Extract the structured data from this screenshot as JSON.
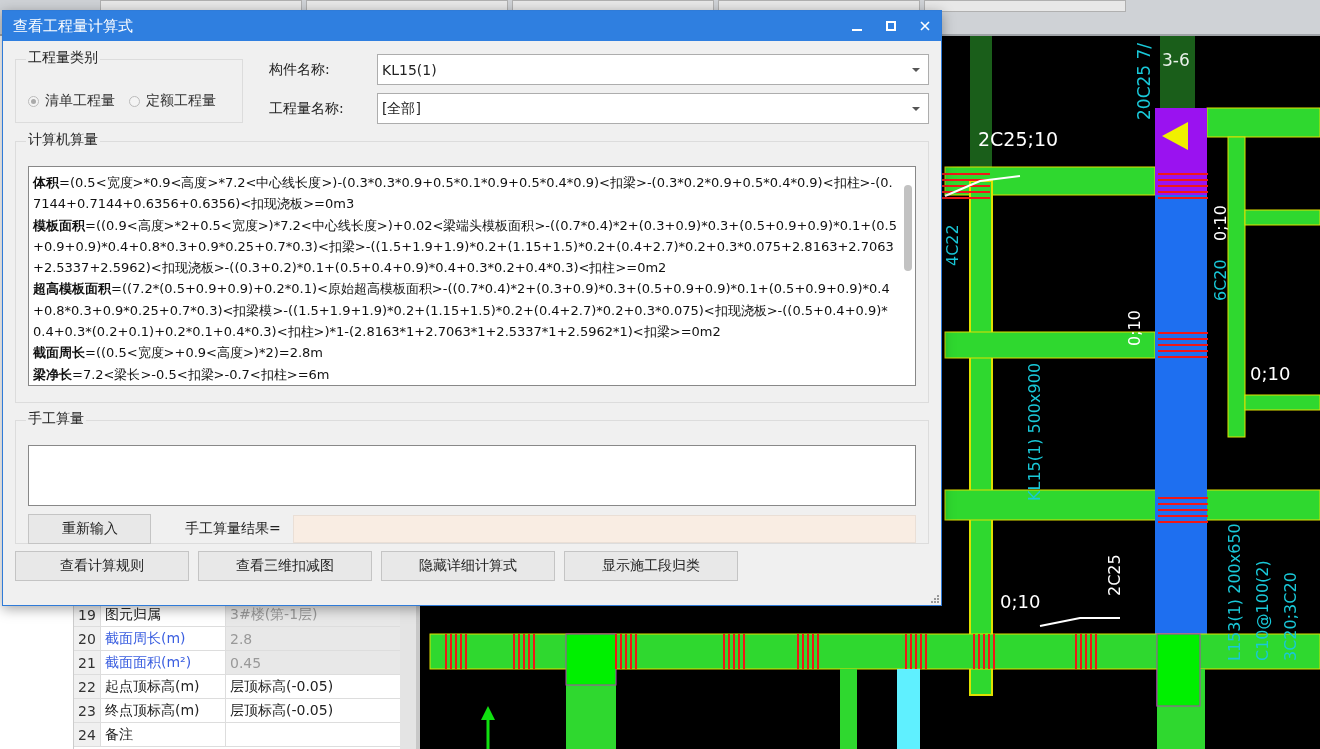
{
  "dialog": {
    "title": "查看工程量计算式",
    "category": {
      "legend": "工程量类别",
      "options": [
        {
          "label": "清单工程量",
          "selected": true
        },
        {
          "label": "定额工程量",
          "selected": false
        }
      ]
    },
    "fields": [
      {
        "label": "构件名称:",
        "value": "KL15(1)"
      },
      {
        "label": "工程量名称:",
        "value": "[全部]"
      }
    ],
    "computed": {
      "legend": "计算机算量",
      "lines": [
        {
          "label": "体积",
          "expr": "=(0.5<宽度>*0.9<高度>*7.2<中心线长度>)-(0.3*0.3*0.9+0.5*0.1*0.9+0.5*0.4*0.9)<扣梁>-(0.3*0.2*0.9+0.5*0.4*0.9)<扣柱>-(0.7144+0.7144+0.6356+0.6356)<扣现浇板>=0m3"
        },
        {
          "label": "模板面积",
          "expr": "=((0.9<高度>*2+0.5<宽度>)*7.2<中心线长度>)+0.02<梁端头模板面积>-((0.7*0.4)*2+(0.3+0.9)*0.3+(0.5+0.9+0.9)*0.1+(0.5+0.9+0.9)*0.4+0.8*0.3+0.9*0.25+0.7*0.3)<扣梁>-((1.5+1.9+1.9)*0.2+(1.15+1.5)*0.2+(0.4+2.7)*0.2+0.3*0.075+2.8163+2.7063+2.5337+2.5962)<扣现浇板>-((0.3+0.2)*0.1+(0.5+0.4+0.9)*0.4+0.3*0.2+0.4*0.3)<扣柱>=0m2"
        },
        {
          "label": "超高模板面积",
          "expr": "=((7.2*(0.5+0.9+0.9)+0.2*0.1)<原始超高模板面积>-((0.7*0.4)*2+(0.3+0.9)*0.3+(0.5+0.9+0.9)*0.1+(0.5+0.9+0.9)*0.4+0.8*0.3+0.9*0.25+0.7*0.3)<扣梁模>-((1.5+1.9+1.9)*0.2+(1.15+1.5)*0.2+(0.4+2.7)*0.2+0.3*0.075)<扣现浇板>-((0.5+0.4+0.9)*0.4+0.3*(0.2+0.1)+0.2*0.1+0.4*0.3)<扣柱>)*1-(2.8163*1+2.7063*1+2.5337*1+2.5962*1)<扣梁>=0m2"
        },
        {
          "label": "截面周长",
          "expr": "=((0.5<宽度>+0.9<高度>)*2)=2.8m"
        },
        {
          "label": "梁净长",
          "expr": "=7.2<梁长>-0.5<扣梁>-0.7<扣柱>=6m"
        }
      ]
    },
    "manual": {
      "legend": "手工算量",
      "reset_button": "重新输入",
      "result_label": "手工算量结果="
    },
    "buttons": [
      "查看计算规则",
      "查看三维扣减图",
      "隐藏详细计算式",
      "显示施工段归类"
    ]
  },
  "properties": [
    {
      "no": "19",
      "name": "图元归属",
      "value": "3#楼(第-1层)",
      "linked": false,
      "readonly": true
    },
    {
      "no": "20",
      "name": "截面周长(m)",
      "value": "2.8",
      "linked": true,
      "readonly": true
    },
    {
      "no": "21",
      "name": "截面面积(m²)",
      "value": "0.45",
      "linked": true,
      "readonly": true
    },
    {
      "no": "22",
      "name": "起点顶标高(m)",
      "value": "层顶标高(-0.05)",
      "linked": false,
      "readonly": false
    },
    {
      "no": "23",
      "name": "终点顶标高(m)",
      "value": "层顶标高(-0.05)",
      "linked": false,
      "readonly": false
    },
    {
      "no": "24",
      "name": "备注",
      "linked": false,
      "readonly": false
    }
  ],
  "cad_labels": [
    {
      "text": "3-6",
      "kind": "horizontal"
    },
    {
      "text": "2C25;10",
      "kind": "horizontal"
    },
    {
      "text": "20C25 7/",
      "kind": "vertical"
    },
    {
      "text": "4C22",
      "kind": "vertical"
    },
    {
      "text": "6C20",
      "kind": "vertical"
    },
    {
      "text": "0;10",
      "kind": "vertical"
    },
    {
      "text": "0;10",
      "kind": "horizontal"
    },
    {
      "text": "0;10",
      "kind": "vertical"
    },
    {
      "text": "KL15(1) 500x900",
      "kind": "vertical"
    },
    {
      "text": "2C25",
      "kind": "vertical"
    },
    {
      "text": "L153(1) 200x650",
      "kind": "vertical"
    },
    {
      "text": "C10@100(2)",
      "kind": "vertical"
    },
    {
      "text": "3C20;3C20",
      "kind": "vertical"
    },
    {
      "text": "0;10",
      "kind": "horizontal"
    }
  ]
}
